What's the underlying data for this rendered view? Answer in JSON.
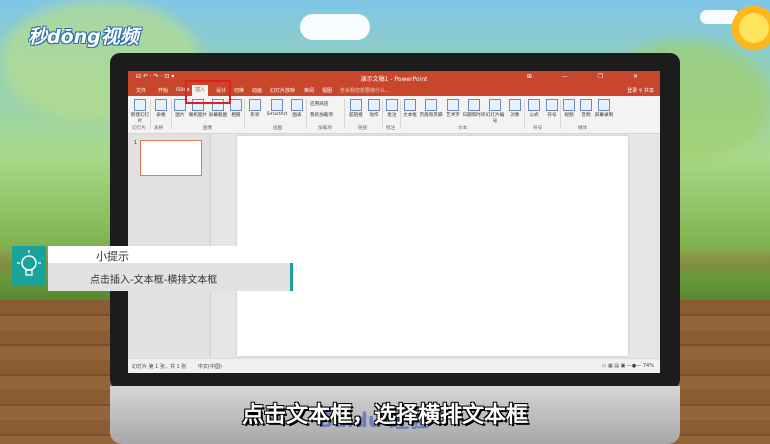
{
  "branding": {
    "logo_text": "秒dōng视频"
  },
  "window": {
    "title": "演示文稿1 - PowerPoint",
    "quick_access": "⊟ ↶ · ↷ · ⊡ ▾",
    "controls": "⊞ — ❐ ✕"
  },
  "menu": {
    "tabs": [
      "文件",
      "开始",
      "iSlide",
      "插入",
      "设计",
      "切换",
      "动画",
      "幻灯片放映",
      "审阅",
      "视图"
    ],
    "active_tab": "插入",
    "search_placeholder": "告诉我您想要做什么...",
    "login": "登录",
    "share": "共享"
  },
  "ribbon": {
    "buttons": [
      "新建幻灯片",
      "表格",
      "图片",
      "联机图片",
      "屏幕截图",
      "相册",
      "形状",
      "SmartArt",
      "图表",
      "应用商店",
      "我的加载项",
      "超链接",
      "动作",
      "批注",
      "文本框",
      "页眉和页脚",
      "艺术字",
      "日期和时间",
      "幻灯片编号",
      "对象",
      "公式",
      "符号",
      "视频",
      "音频",
      "屏幕录制"
    ],
    "groups": [
      "幻灯片",
      "表格",
      "图像",
      "插图",
      "加载项",
      "链接",
      "批注",
      "文本",
      "符号",
      "媒体"
    ]
  },
  "thumbnails": [
    {
      "number": "1"
    }
  ],
  "status": {
    "slide_info": "幻灯片 第 1 张，共 1 张",
    "language": "中文(中国)",
    "zoom": "74%"
  },
  "tip": {
    "title": "小提示",
    "body": "点击插入-文本框-横排文本框"
  },
  "caption": "点击文本框，选择横排文本框",
  "watermark": "Baidu 经验",
  "colors": {
    "ppt_accent": "#c8462c",
    "tip_accent": "#1aa39a",
    "highlight": "#e0201a"
  }
}
